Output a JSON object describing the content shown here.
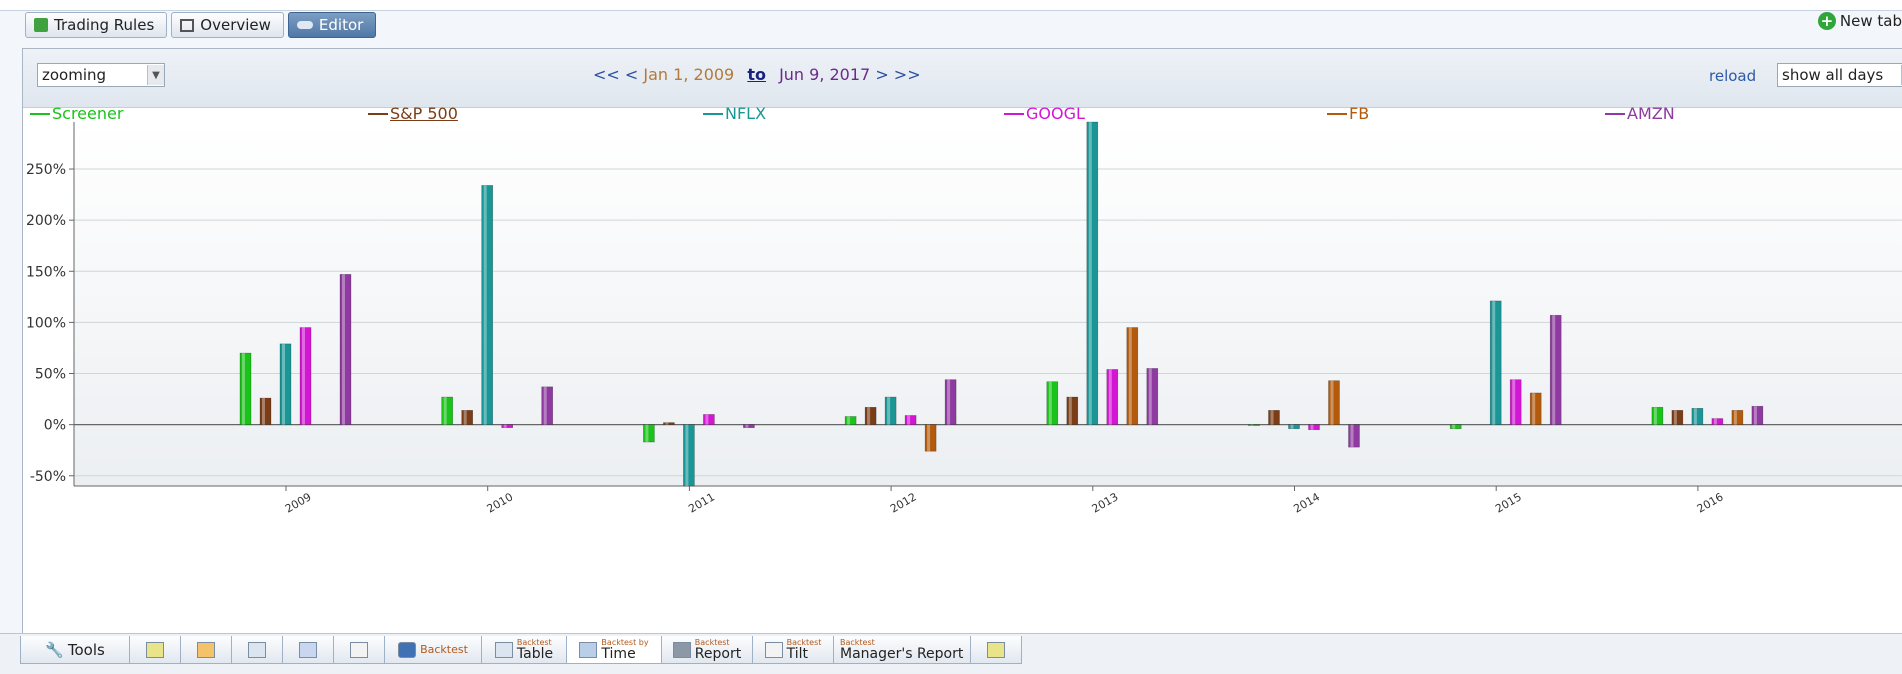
{
  "top_tabs": [
    {
      "label": "Trading Rules",
      "icon": "trading-rules-icon"
    },
    {
      "label": "Overview",
      "icon": "overview-icon"
    },
    {
      "label": "Editor",
      "icon": "editor-icon",
      "active": true
    }
  ],
  "new_tab_label": "New tab",
  "toolbar": {
    "zoom_value": "zooming",
    "nav_back": "<< <",
    "start_date": "Jan 1, 2009",
    "to_label": "to",
    "end_date": "Jun 9, 2017",
    "nav_forward": "> >>",
    "reload_label": "reload",
    "show_value": "show all days"
  },
  "bottom_tabs": [
    {
      "label": "Tools",
      "icon": "wrench-icon"
    },
    {
      "label": "",
      "icon": "stack-icon"
    },
    {
      "label": "",
      "icon": "chart-icon"
    },
    {
      "label": "",
      "icon": "table-icon"
    },
    {
      "label": "",
      "icon": "bar-icon"
    },
    {
      "label": "",
      "icon": "scatter-icon"
    },
    {
      "small": "",
      "label": "Backtest",
      "icon": "backtest-icon"
    },
    {
      "small": "Backtest",
      "label": "Table",
      "icon": "table-icon"
    },
    {
      "small": "Backtest by",
      "label": "Time",
      "icon": "time-bars-icon",
      "selected": true
    },
    {
      "small": "Backtest",
      "label": "Report",
      "icon": "report-icon"
    },
    {
      "small": "Backtest",
      "label": "Tilt",
      "icon": "tilt-icon"
    },
    {
      "small": "Backtest",
      "label": "Manager's Report",
      "icon": ""
    },
    {
      "label": "",
      "icon": "stack-icon"
    }
  ],
  "colors": {
    "Screener": "#19c319",
    "S&P 500": "#7a3d17",
    "NFLX": "#1a9696",
    "GOOGL": "#d316d3",
    "FB": "#b35a0c",
    "AMZN": "#8f3aa0"
  },
  "chart_data": {
    "type": "bar",
    "categories": [
      "2009",
      "2010",
      "2011",
      "2012",
      "2013",
      "2014",
      "2015",
      "2016"
    ],
    "series": [
      {
        "name": "Screener",
        "values": [
          70,
          27,
          -17,
          8,
          42,
          -1,
          -4,
          17
        ]
      },
      {
        "name": "S&P 500",
        "values": [
          26,
          14,
          2,
          17,
          27,
          14,
          null,
          14
        ]
      },
      {
        "name": "NFLX",
        "values": [
          79,
          234,
          -60,
          27,
          296,
          -4,
          121,
          16
        ]
      },
      {
        "name": "GOOGL",
        "values": [
          95,
          -3,
          10,
          9,
          54,
          -5,
          44,
          6
        ]
      },
      {
        "name": "FB",
        "values": [
          null,
          null,
          null,
          -26,
          95,
          43,
          31,
          14
        ]
      },
      {
        "name": "AMZN",
        "values": [
          147,
          37,
          -3,
          44,
          55,
          -22,
          107,
          18
        ]
      }
    ],
    "legend_order": [
      "Screener",
      "S&P 500",
      "NFLX",
      "GOOGL",
      "FB",
      "AMZN"
    ],
    "y_ticks": [
      "250%",
      "200%",
      "150%",
      "100%",
      "50%",
      "0%",
      "-50%"
    ],
    "y_tick_values": [
      250,
      200,
      150,
      100,
      50,
      0,
      -50
    ],
    "ylim": [
      -60,
      296
    ],
    "legend_position": "top",
    "grid": true
  }
}
